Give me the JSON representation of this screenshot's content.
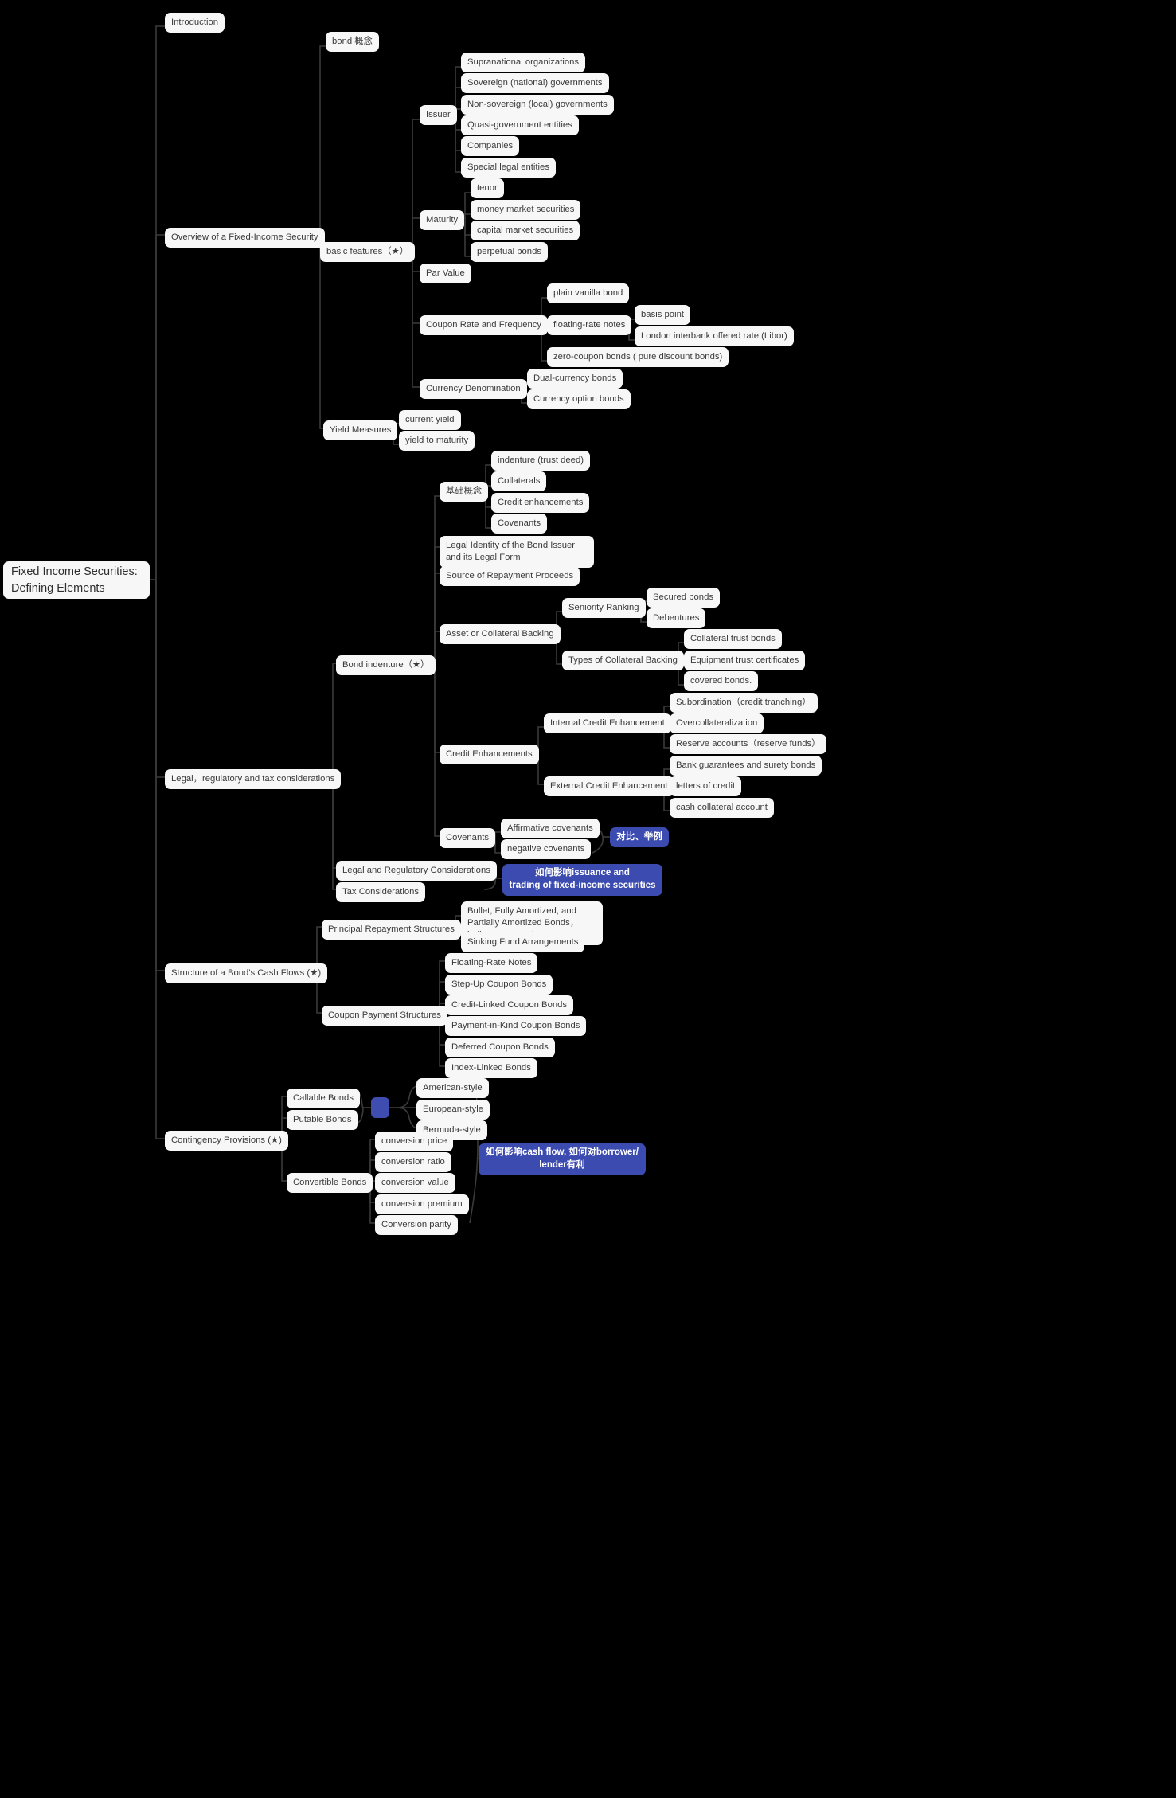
{
  "title": "Fixed Income Securities: Defining Elements",
  "root": {
    "label": "Fixed Income Securities:\nDefining Elements"
  },
  "branches": {
    "introduction": "Introduction",
    "overview": "Overview of a Fixed-Income Security",
    "legal": "Legal，regulatory and tax considerations",
    "cashflows": "Structure of a Bond's Cash Flows (★)",
    "contingency": "Contingency Provisions (★)"
  },
  "overview": {
    "bond_concept": "bond 概念",
    "basic_features": "basic features（★）",
    "yield_measures": "Yield Measures",
    "issuer": {
      "label": "Issuer",
      "children": [
        "Supranational organizations",
        "Sovereign (national) governments",
        "Non-sovereign (local) governments",
        "Quasi-government entities",
        "Companies",
        "Special legal entities"
      ]
    },
    "maturity": {
      "label": "Maturity",
      "children": [
        "tenor",
        "money market securities",
        "capital market securities",
        "perpetual bonds"
      ]
    },
    "par_value": "Par Value",
    "coupon": {
      "label": "Coupon Rate and Frequency",
      "children": [
        "plain vanilla bond",
        "floating-rate notes",
        "zero-coupon bonds ( pure discount bonds)"
      ],
      "frn_children": [
        "basis point",
        "London interbank offered rate (Libor)"
      ]
    },
    "currency": {
      "label": "Currency Denomination",
      "children": [
        "Dual-currency bonds",
        "Currency option bonds"
      ]
    },
    "yields": [
      "current yield",
      "yield to maturity"
    ]
  },
  "legal": {
    "bond_indenture": "Bond indenture（★）",
    "legal_reg": "Legal and Regulatory Considerations",
    "tax": "Tax Considerations",
    "basic_concepts": {
      "label": "基础概念",
      "children": [
        "indenture (trust deed)",
        "Collaterals",
        "Credit enhancements",
        "Covenants"
      ]
    },
    "legal_identity": "Legal Identity of the Bond Issuer and its Legal Form",
    "source_repayment": "Source of Repayment Proceeds",
    "asset_backing": {
      "label": "Asset or Collateral Backing",
      "seniority": {
        "label": "Seniority Ranking",
        "children": [
          "Secured bonds",
          "Debentures"
        ]
      },
      "types": {
        "label": "Types of Collateral Backing",
        "children": [
          "Collateral trust bonds",
          "Equipment trust certificates",
          "covered bonds."
        ]
      }
    },
    "credit_enhancements": {
      "label": "Credit Enhancements",
      "internal": {
        "label": "Internal Credit Enhancement",
        "children": [
          "Subordination（credit tranching）",
          "Overcollateralization",
          "Reserve accounts（reserve funds）"
        ]
      },
      "external": {
        "label": "External Credit Enhancement",
        "children": [
          "Bank guarantees and surety bonds",
          "letters of credit",
          "cash collateral account"
        ]
      }
    },
    "covenants": {
      "label": "Covenants",
      "children": [
        "Affirmative covenants",
        "negative covenants"
      ]
    },
    "note_covenants": "对比、举例",
    "note_legal_tax": "如何影响issuance and\ntrading of fixed-income securities"
  },
  "cashflows": {
    "principal": {
      "label": "Principal Repayment Structures",
      "children": [
        "Bullet, Fully Amortized, and Partially Amortized Bonds，balloon payment",
        "Sinking Fund Arrangements"
      ]
    },
    "coupon_structures": {
      "label": "Coupon Payment Structures",
      "children": [
        "Floating-Rate Notes",
        "Step-Up Coupon Bonds",
        "Credit-Linked Coupon Bonds",
        "Payment-in-Kind Coupon Bonds",
        "Deferred Coupon Bonds",
        "Index-Linked Bonds"
      ]
    }
  },
  "contingency": {
    "callable": "Callable Bonds",
    "putable": "Putable Bonds",
    "convertible": "Convertible Bonds",
    "styles": [
      "American-style",
      "European-style",
      "Bermuda-style"
    ],
    "convertible_terms": [
      "conversion price",
      "conversion ratio",
      "conversion value",
      "conversion premium",
      "Conversion parity"
    ],
    "note": "如何影响cash flow, 如何对borrower/\nlender有利"
  },
  "colors": {
    "background": "#000000",
    "node_bg": "#f7f7f7",
    "node_text": "#3b3b3b",
    "edge": "#3a3a3a",
    "highlight_bg": "#3c4bb0",
    "highlight_text": "#ffffff"
  }
}
